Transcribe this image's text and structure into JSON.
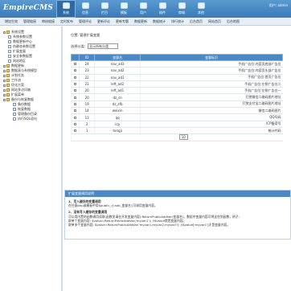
{
  "header": {
    "logo": "EmpireCMS",
    "user": "用户: admin",
    "nav": [
      {
        "label": "系统",
        "active": true
      },
      {
        "label": "信息"
      },
      {
        "label": "栏目"
      },
      {
        "label": "模板"
      },
      {
        "label": "用户"
      },
      {
        "label": "插件"
      },
      {
        "label": "商城"
      },
      {
        "label": "其他"
      }
    ]
  },
  "subnav": [
    "增加生效",
    "管理链接",
    "审核链接",
    "定时发布",
    "管理评论",
    "更新评论",
    "更新专题",
    "数据更新",
    "数据统计",
    "排行统计",
    "后台首页",
    "网站首页",
    "后台地图"
  ],
  "sidebar": [
    {
      "label": "系统设置",
      "level": 1,
      "type": "folder"
    },
    {
      "label": "系统参数设置",
      "level": 2,
      "type": "page"
    },
    {
      "label": "数据更新中心",
      "level": 2,
      "type": "page"
    },
    {
      "label": "伪静态参数设置",
      "level": 2,
      "type": "page"
    },
    {
      "label": "扩展变量",
      "level": 2,
      "type": "page"
    },
    {
      "label": "安全参数配置",
      "level": 2,
      "type": "page"
    },
    {
      "label": "网站地区",
      "level": 2,
      "type": "page"
    },
    {
      "label": "数据更新",
      "level": 1,
      "type": "folder"
    },
    {
      "label": "数据表与系统模型",
      "level": 1,
      "type": "folder"
    },
    {
      "label": "计划任务",
      "level": 1,
      "type": "folder"
    },
    {
      "label": "工作流",
      "level": 1,
      "type": "folder"
    },
    {
      "label": "优化方案",
      "level": 1,
      "type": "folder"
    },
    {
      "label": "网站多访问端",
      "level": 1,
      "type": "folder"
    },
    {
      "label": "扩展菜单",
      "level": 1,
      "type": "folder"
    },
    {
      "label": "备份与恢复数据",
      "level": 1,
      "type": "folder"
    },
    {
      "label": "备份数据",
      "level": 3,
      "type": "page"
    },
    {
      "label": "恢复数据",
      "level": 3,
      "type": "page"
    },
    {
      "label": "管理备份目录",
      "level": 3,
      "type": "page"
    },
    {
      "label": "执行SQL语句",
      "level": 3,
      "type": "page"
    }
  ],
  "main": {
    "breadcrumb": "位置: 管理扩展变量",
    "filter_label": "选择分类:",
    "filter_value": "显示所有分类",
    "columns": [
      "ID",
      "变量名",
      "变量标识"
    ],
    "rows": [
      {
        "id": "24",
        "name": "nav_ad3",
        "desc": "手机广告位:内容页底部广告位"
      },
      {
        "id": "23",
        "name": "nav_ad2",
        "desc": "手机广告位:内容页头部广告位"
      },
      {
        "id": "22",
        "name": "nav_ad1",
        "desc": "手机广告位:首页广告位"
      },
      {
        "id": "21",
        "name": "left_ad2",
        "desc": "手机广告位:左侧广告位二"
      },
      {
        "id": "20",
        "name": "left_ad1",
        "desc": "手机广告位:左侧广告位一"
      },
      {
        "id": "20",
        "name": "dz_cn",
        "desc": "打赏微信二维码图片地址"
      },
      {
        "id": "19",
        "name": "dz_zfb",
        "desc": "打赏支付宝二维码图片地址"
      },
      {
        "id": "14",
        "name": "weixin",
        "desc": "微信二维码图片"
      },
      {
        "id": "13",
        "name": "qq",
        "desc": "QQ号码"
      },
      {
        "id": "2",
        "name": "icp",
        "desc": "ICP备案号"
      },
      {
        "id": "1",
        "name": "tongji",
        "desc": "统计代码"
      }
    ],
    "total": "10"
  },
  "help": {
    "title": "扩展变量调用说明",
    "h1": "1、写入缓存的变量调用",
    "p1": "在任意php或模板中用$public_r['add_变量名']可调用变量内容。",
    "h2": "2、没有写入缓存的变量调用",
    "p2": "可以用内置的函数调用读取(函数显请在开发变量内容):ReturnPublicAddVar(变量名)。数组中变量内容可将这些到函数，例子:",
    "p3": "取单个变量内容: $value=ReturnPublicAddVar('myvar1'); //$value就是变量内容。",
    "p4": "取单多个变量内容: $value=ReturnPublicAddVar('myvar1,myvar2,myvar3'); //$value['myvar1']才是变量内容。"
  }
}
